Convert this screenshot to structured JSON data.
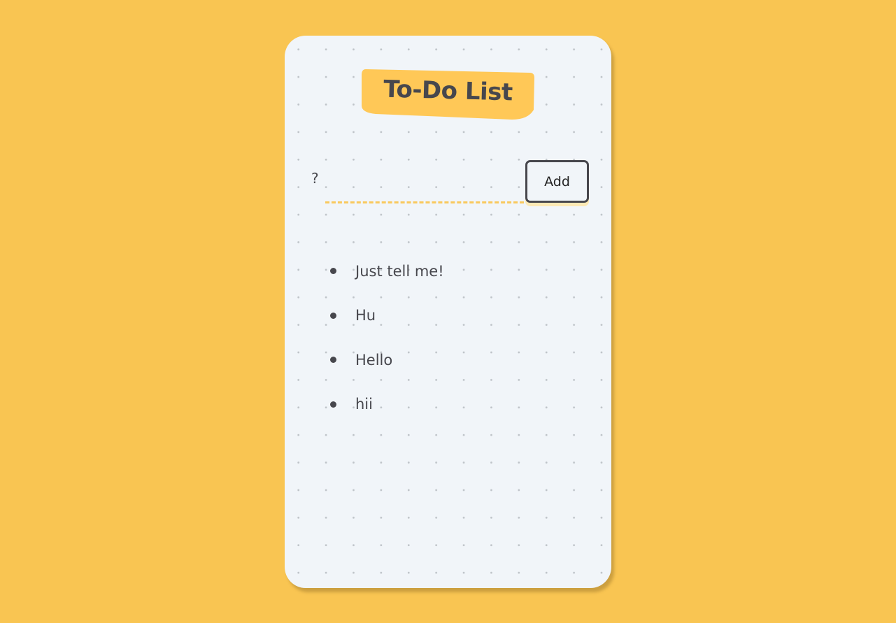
{
  "app": {
    "title": "To-Do List"
  },
  "form": {
    "prompt_label": "?",
    "input_value": "",
    "input_placeholder": "",
    "add_label": "Add"
  },
  "todos": [
    {
      "text": "Just tell me!"
    },
    {
      "text": "Hu"
    },
    {
      "text": "Hello"
    },
    {
      "text": "hii"
    }
  ],
  "colors": {
    "page_background": "#F9C552",
    "card_background": "#F1F5F9",
    "title_highlight": "#FFC857",
    "text": "#47474D",
    "dash_underline": "#F9C95E",
    "dot_grid": "#BFC4C9"
  }
}
